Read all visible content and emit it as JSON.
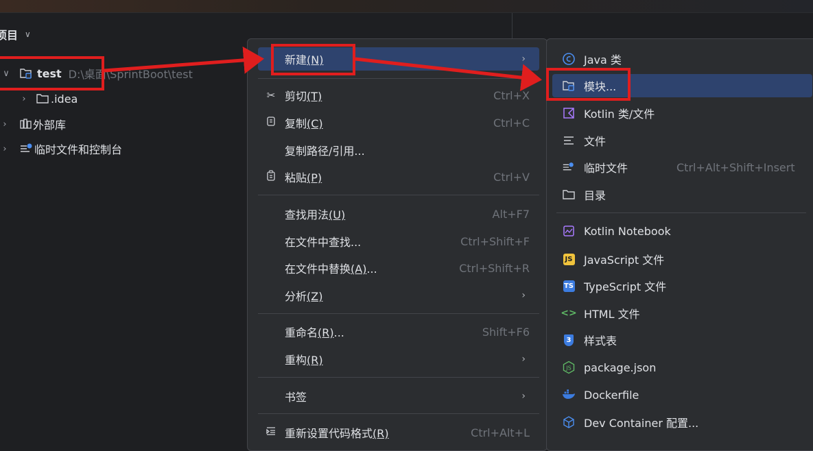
{
  "project_panel": {
    "title": "项目",
    "tree": [
      {
        "name": "test",
        "path": "D:\\桌面\\SprintBoot\\test"
      },
      {
        "name": ".idea"
      },
      {
        "name": "外部库"
      },
      {
        "name": "临时文件和控制台"
      }
    ]
  },
  "context_menu": {
    "new": {
      "label": "新建",
      "mnemonic": "(N)"
    },
    "cut": {
      "label": "剪切",
      "mnemonic": "(T)",
      "shortcut": "Ctrl+X"
    },
    "copy": {
      "label": "复制",
      "mnemonic": "(C)",
      "shortcut": "Ctrl+C"
    },
    "copy_path": {
      "label": "复制路径/引用..."
    },
    "paste": {
      "label": "粘贴",
      "mnemonic": "(P)",
      "shortcut": "Ctrl+V"
    },
    "find_usages": {
      "label": "查找用法",
      "mnemonic": "(U)",
      "shortcut": "Alt+F7"
    },
    "find_in_files": {
      "label": "在文件中查找...",
      "shortcut": "Ctrl+Shift+F"
    },
    "replace_in_files": {
      "label": "在文件中替换",
      "mnemonic": "(A)",
      "suffix": "...",
      "shortcut": "Ctrl+Shift+R"
    },
    "analyze": {
      "label": "分析",
      "mnemonic": "(Z)"
    },
    "rename": {
      "label": "重命名",
      "mnemonic": "(R)",
      "suffix": "...",
      "shortcut": "Shift+F6"
    },
    "refactor": {
      "label": "重构",
      "mnemonic": "(R)"
    },
    "bookmarks": {
      "label": "书签"
    },
    "reformat": {
      "label": "重新设置代码格式",
      "mnemonic": "(R)",
      "shortcut": "Ctrl+Alt+L"
    }
  },
  "new_submenu": {
    "items": [
      {
        "label": "Java 类",
        "icon": "java-class-icon"
      },
      {
        "label": "模块...",
        "icon": "module-icon"
      },
      {
        "label": "Kotlin 类/文件",
        "icon": "kotlin-icon"
      },
      {
        "label": "文件",
        "icon": "file-icon"
      },
      {
        "label": "临时文件",
        "shortcut": "Ctrl+Alt+Shift+Insert",
        "icon": "scratch-file-icon"
      },
      {
        "label": "目录",
        "icon": "directory-icon"
      },
      {
        "label": "Kotlin Notebook",
        "icon": "kotlin-notebook-icon"
      },
      {
        "label": "JavaScript 文件",
        "icon": "javascript-icon"
      },
      {
        "label": "TypeScript 文件",
        "icon": "typescript-icon"
      },
      {
        "label": "HTML 文件",
        "icon": "html-icon"
      },
      {
        "label": "样式表",
        "icon": "css-icon"
      },
      {
        "label": "package.json",
        "icon": "package-json-icon"
      },
      {
        "label": "Dockerfile",
        "icon": "docker-icon"
      },
      {
        "label": "Dev Container 配置...",
        "icon": "dev-container-icon"
      }
    ],
    "badges": {
      "js": "JS",
      "ts": "TS",
      "css": "3"
    }
  },
  "colors": {
    "highlight": "#2e436e",
    "annotation_red": "#e01e1e",
    "menu_bg": "#2b2d30",
    "panel_bg": "#1e1f22"
  }
}
